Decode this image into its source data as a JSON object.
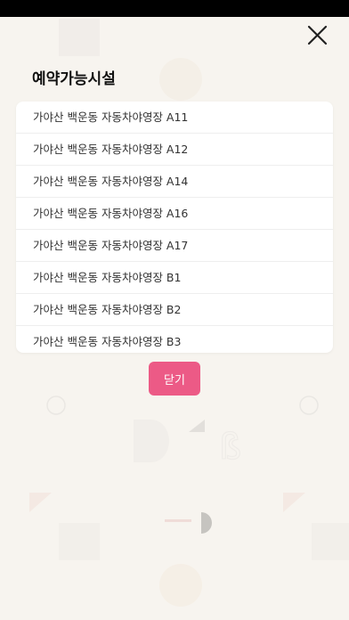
{
  "dialog": {
    "title": "예약가능시설",
    "close_button_label": "닫기"
  },
  "facilities": [
    "가야산 백운동 자동차야영장 A11",
    "가야산 백운동 자동차야영장 A12",
    "가야산 백운동 자동차야영장 A14",
    "가야산 백운동 자동차야영장 A16",
    "가야산 백운동 자동차야영장 A17",
    "가야산 백운동 자동차야영장 B1",
    "가야산 백운동 자동차야영장 B2",
    "가야산 백운동 자동차야영장 B3"
  ],
  "colors": {
    "accent": "#ec5a86",
    "background": "#f7f4ef",
    "status_bar": "#000000"
  },
  "icons": {
    "close": "close-icon"
  }
}
